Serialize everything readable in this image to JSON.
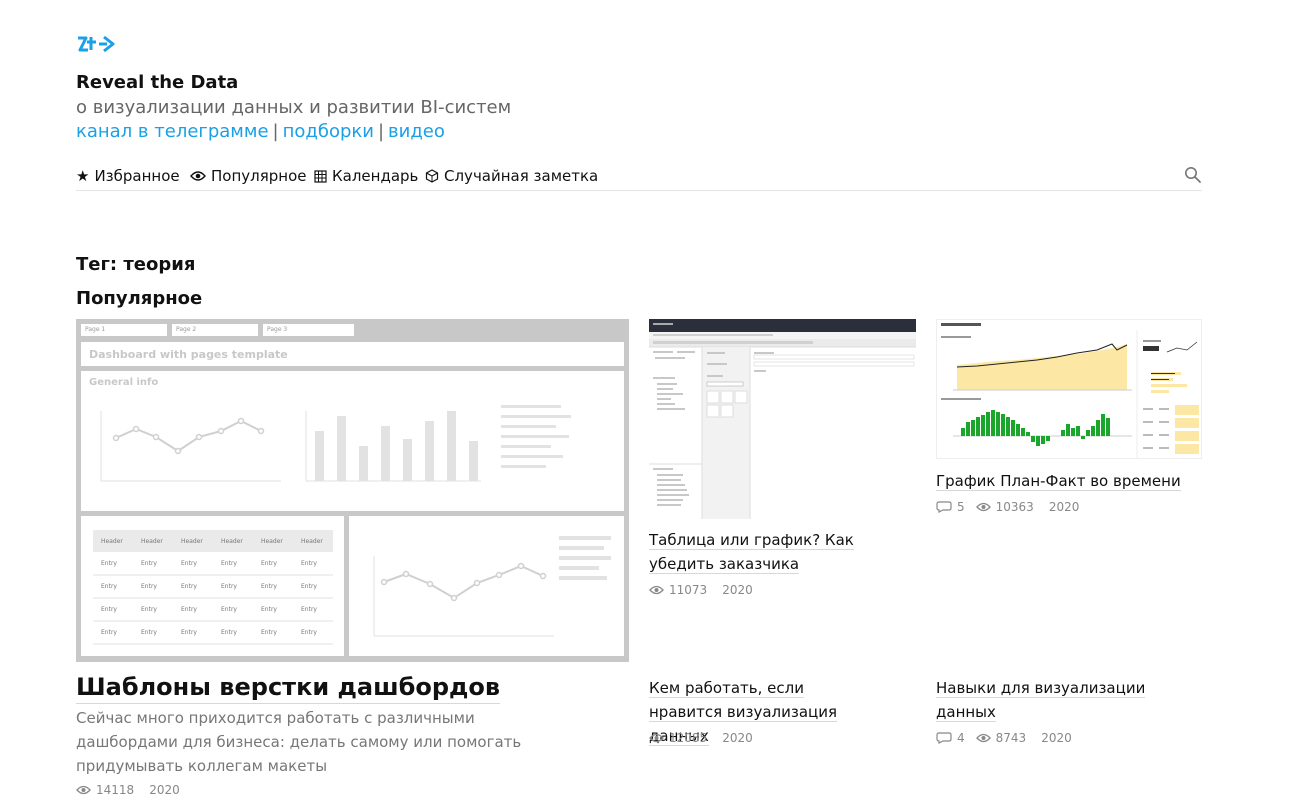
{
  "site": {
    "title": "Reveal the Data",
    "subtitle": "о визуализации данных и развитии BI-систем",
    "links": [
      "канал в телеграмме",
      "подборки",
      "видео"
    ]
  },
  "nav": {
    "items": [
      {
        "icon": "★",
        "label": "Избранное"
      },
      {
        "icon": "👁",
        "label": "Популярное"
      },
      {
        "icon": "▦",
        "label": "Календарь"
      },
      {
        "icon": "⬡",
        "label": "Случайная заметка"
      }
    ]
  },
  "page": {
    "tag_title": "Тег: теория",
    "section_title": "Популярное"
  },
  "featured": {
    "title": "Шаблоны верстки дашбордов",
    "description": "Сейчас много приходится работать с различными дашбордами для бизнеса: делать самому или помогать придумывать коллегам макеты",
    "views": "14118",
    "year": "2020",
    "thumb": {
      "tabs": [
        "Page 1",
        "Page 2",
        "Page 3"
      ],
      "heading": "Dashboard with pages template",
      "general": "General info",
      "table_header": [
        "Header",
        "Header",
        "Header",
        "Header",
        "Header",
        "Header"
      ],
      "table_cell": "Entry"
    }
  },
  "cards": [
    {
      "title": "Таблица или график? Как убедить заказчика",
      "views": "11073",
      "year": "2020"
    },
    {
      "title": "График План-Факт во времени",
      "comments": "5",
      "views": "10363",
      "year": "2020"
    },
    {
      "title": "Кем работать, если нравится визуализация данных",
      "views": "12085",
      "year": "2020"
    },
    {
      "title": "Навыки для визуализации данных",
      "comments": "4",
      "views": "8743",
      "year": "2020"
    }
  ],
  "colors": {
    "link": "#1aa0e6",
    "accent_green": "#1aa62a",
    "accent_yellow": "#fce8a4"
  }
}
